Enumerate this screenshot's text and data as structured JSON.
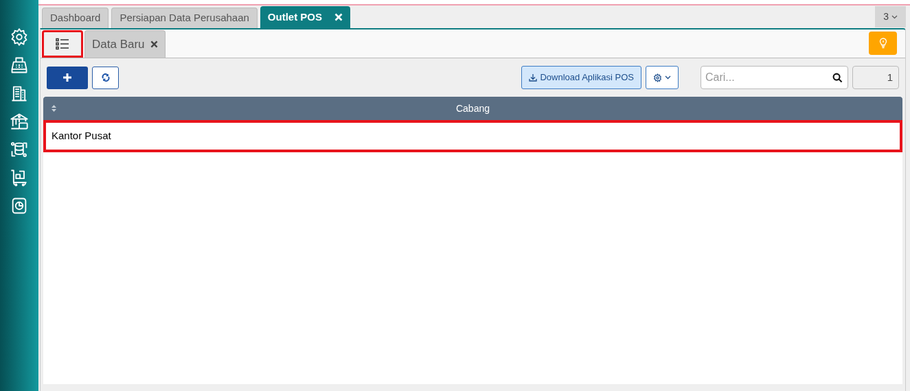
{
  "tabs": [
    {
      "label": "Dashboard",
      "selected": false,
      "closable": false
    },
    {
      "label": "Persiapan Data Perusahaan",
      "selected": false,
      "closable": false
    },
    {
      "label": "Outlet POS",
      "selected": true,
      "closable": true
    }
  ],
  "tab_overflow": {
    "count": "3"
  },
  "subtabs": [
    {
      "kind": "icon",
      "selected": true,
      "highlighted": true
    },
    {
      "kind": "label",
      "label": "Data Baru",
      "selected": false,
      "highlighted": false
    }
  ],
  "toolbar": {
    "download_button": "Download Aplikasi POS",
    "search": {
      "placeholder": "Cari..."
    },
    "page": "1"
  },
  "table": {
    "columns": [
      "Cabang"
    ],
    "rows": [
      {
        "cells": [
          "Kantor Pusat"
        ],
        "highlighted": true
      }
    ]
  }
}
